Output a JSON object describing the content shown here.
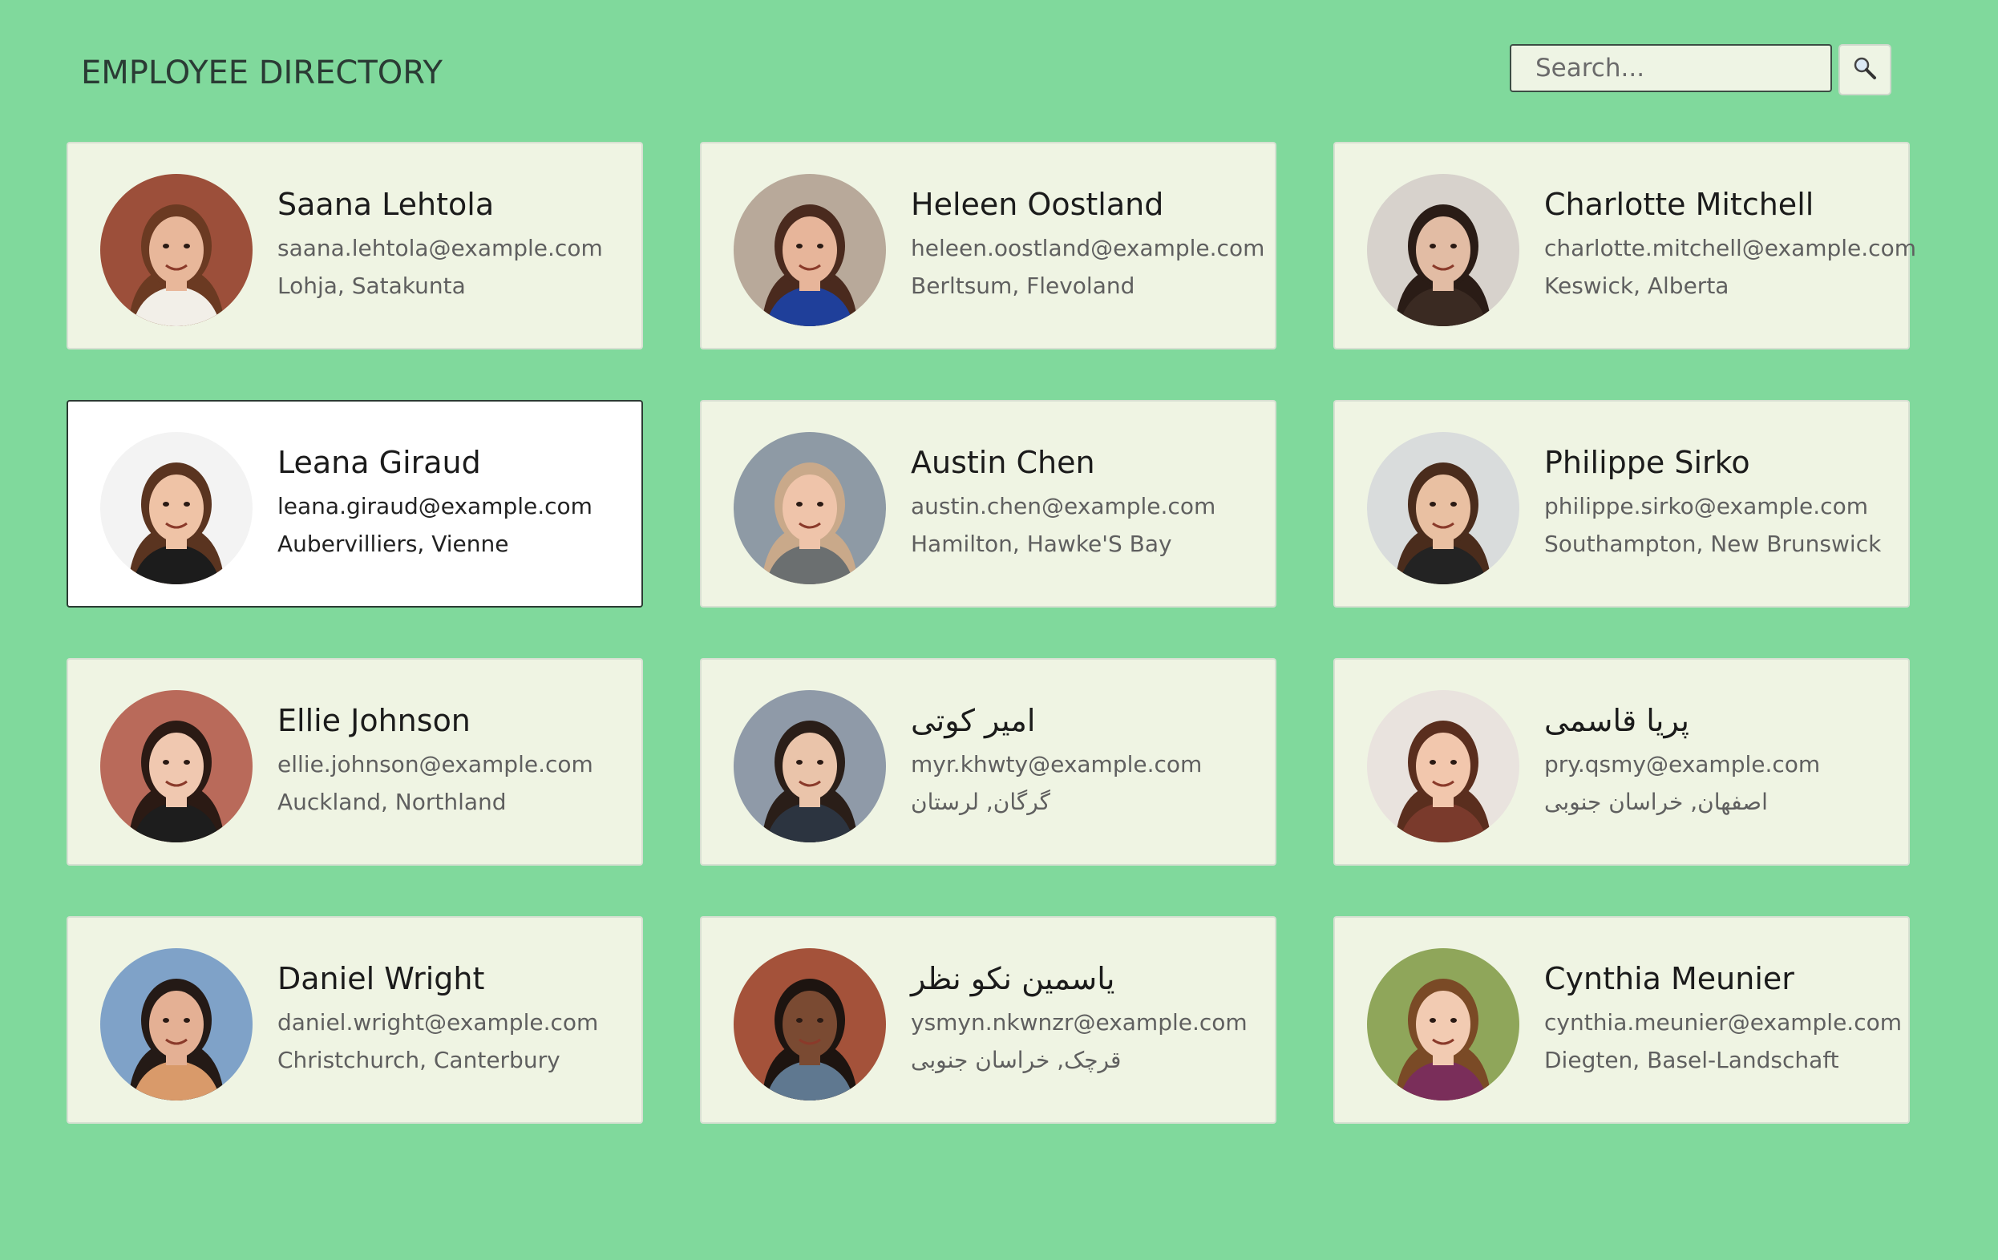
{
  "header": {
    "title": "EMPLOYEE DIRECTORY"
  },
  "search": {
    "placeholder": "Search...",
    "value": "",
    "button_icon": "search-icon"
  },
  "colors": {
    "background": "#80d99c",
    "card": "#eff4e3",
    "card_selected": "#ffffff"
  },
  "employees": [
    {
      "name": "Saana Lehtola",
      "email": "saana.lehtola@example.com",
      "location": "Lohja, Satakunta",
      "selected": false,
      "skin": "#e8b79a",
      "hair": "#6b3a22",
      "bg": "#9c4f3a",
      "shirt": "#f2efe8"
    },
    {
      "name": "Heleen Oostland",
      "email": "heleen.oostland@example.com",
      "location": "Berltsum, Flevoland",
      "selected": false,
      "skin": "#e7b59a",
      "hair": "#4a2a1e",
      "bg": "#b8a99a",
      "shirt": "#1f3f9a"
    },
    {
      "name": "Charlotte Mitchell",
      "email": "charlotte.mitchell@example.com",
      "location": "Keswick, Alberta",
      "selected": false,
      "skin": "#e2bca4",
      "hair": "#2a1c16",
      "bg": "#d7d2cc",
      "shirt": "#3a2a22"
    },
    {
      "name": "Leana Giraud",
      "email": "leana.giraud@example.com",
      "location": "Aubervilliers, Vienne",
      "selected": true,
      "skin": "#efc3a6",
      "hair": "#5a3420",
      "bg": "#f3f3f3",
      "shirt": "#1c1c1c"
    },
    {
      "name": "Austin Chen",
      "email": "austin.chen@example.com",
      "location": "Hamilton, Hawke'S Bay",
      "selected": false,
      "skin": "#efc4aa",
      "hair": "#c9a98a",
      "bg": "#8e9aa5",
      "shirt": "#6b6f70"
    },
    {
      "name": "Philippe Sirko",
      "email": "philippe.sirko@example.com",
      "location": "Southampton, New Brunswick",
      "selected": false,
      "skin": "#e9c0a2",
      "hair": "#4a2c1c",
      "bg": "#d9dcdc",
      "shirt": "#232323"
    },
    {
      "name": "Ellie Johnson",
      "email": "ellie.johnson@example.com",
      "location": "Auckland, Northland",
      "selected": false,
      "skin": "#f0c8b0",
      "hair": "#2b1a14",
      "bg": "#b96a5a",
      "shirt": "#1d1d1d"
    },
    {
      "name": "امیر کوتی",
      "email": "myr.khwty@example.com",
      "location": "گرگان, لرستان",
      "selected": false,
      "skin": "#eac4aa",
      "hair": "#2a1e18",
      "bg": "#8f9aa8",
      "shirt": "#2c3440"
    },
    {
      "name": "پریا قاسمی",
      "email": "pry.qsmy@example.com",
      "location": "اصفهان, خراسان جنوبی",
      "selected": false,
      "skin": "#f2c7ad",
      "hair": "#5a2e1e",
      "bg": "#e9e3de",
      "shirt": "#7a3a2c"
    },
    {
      "name": "Daniel Wright",
      "email": "daniel.wright@example.com",
      "location": "Christchurch, Canterbury",
      "selected": false,
      "skin": "#e4b094",
      "hair": "#241a16",
      "bg": "#7fa2c8",
      "shirt": "#d99a6a"
    },
    {
      "name": "یاسمین نکو نظر",
      "email": "ysmyn.nkwnzr@example.com",
      "location": "قرچک, خراسان جنوبی",
      "selected": false,
      "skin": "#7a4a32",
      "hair": "#1d1410",
      "bg": "#a4523a",
      "shirt": "#5f7890"
    },
    {
      "name": "Cynthia Meunier",
      "email": "cynthia.meunier@example.com",
      "location": "Diegten, Basel-Landschaft",
      "selected": false,
      "skin": "#f2cbb2",
      "hair": "#7a4a26",
      "bg": "#8fa65a",
      "shirt": "#7a2e5a"
    }
  ]
}
